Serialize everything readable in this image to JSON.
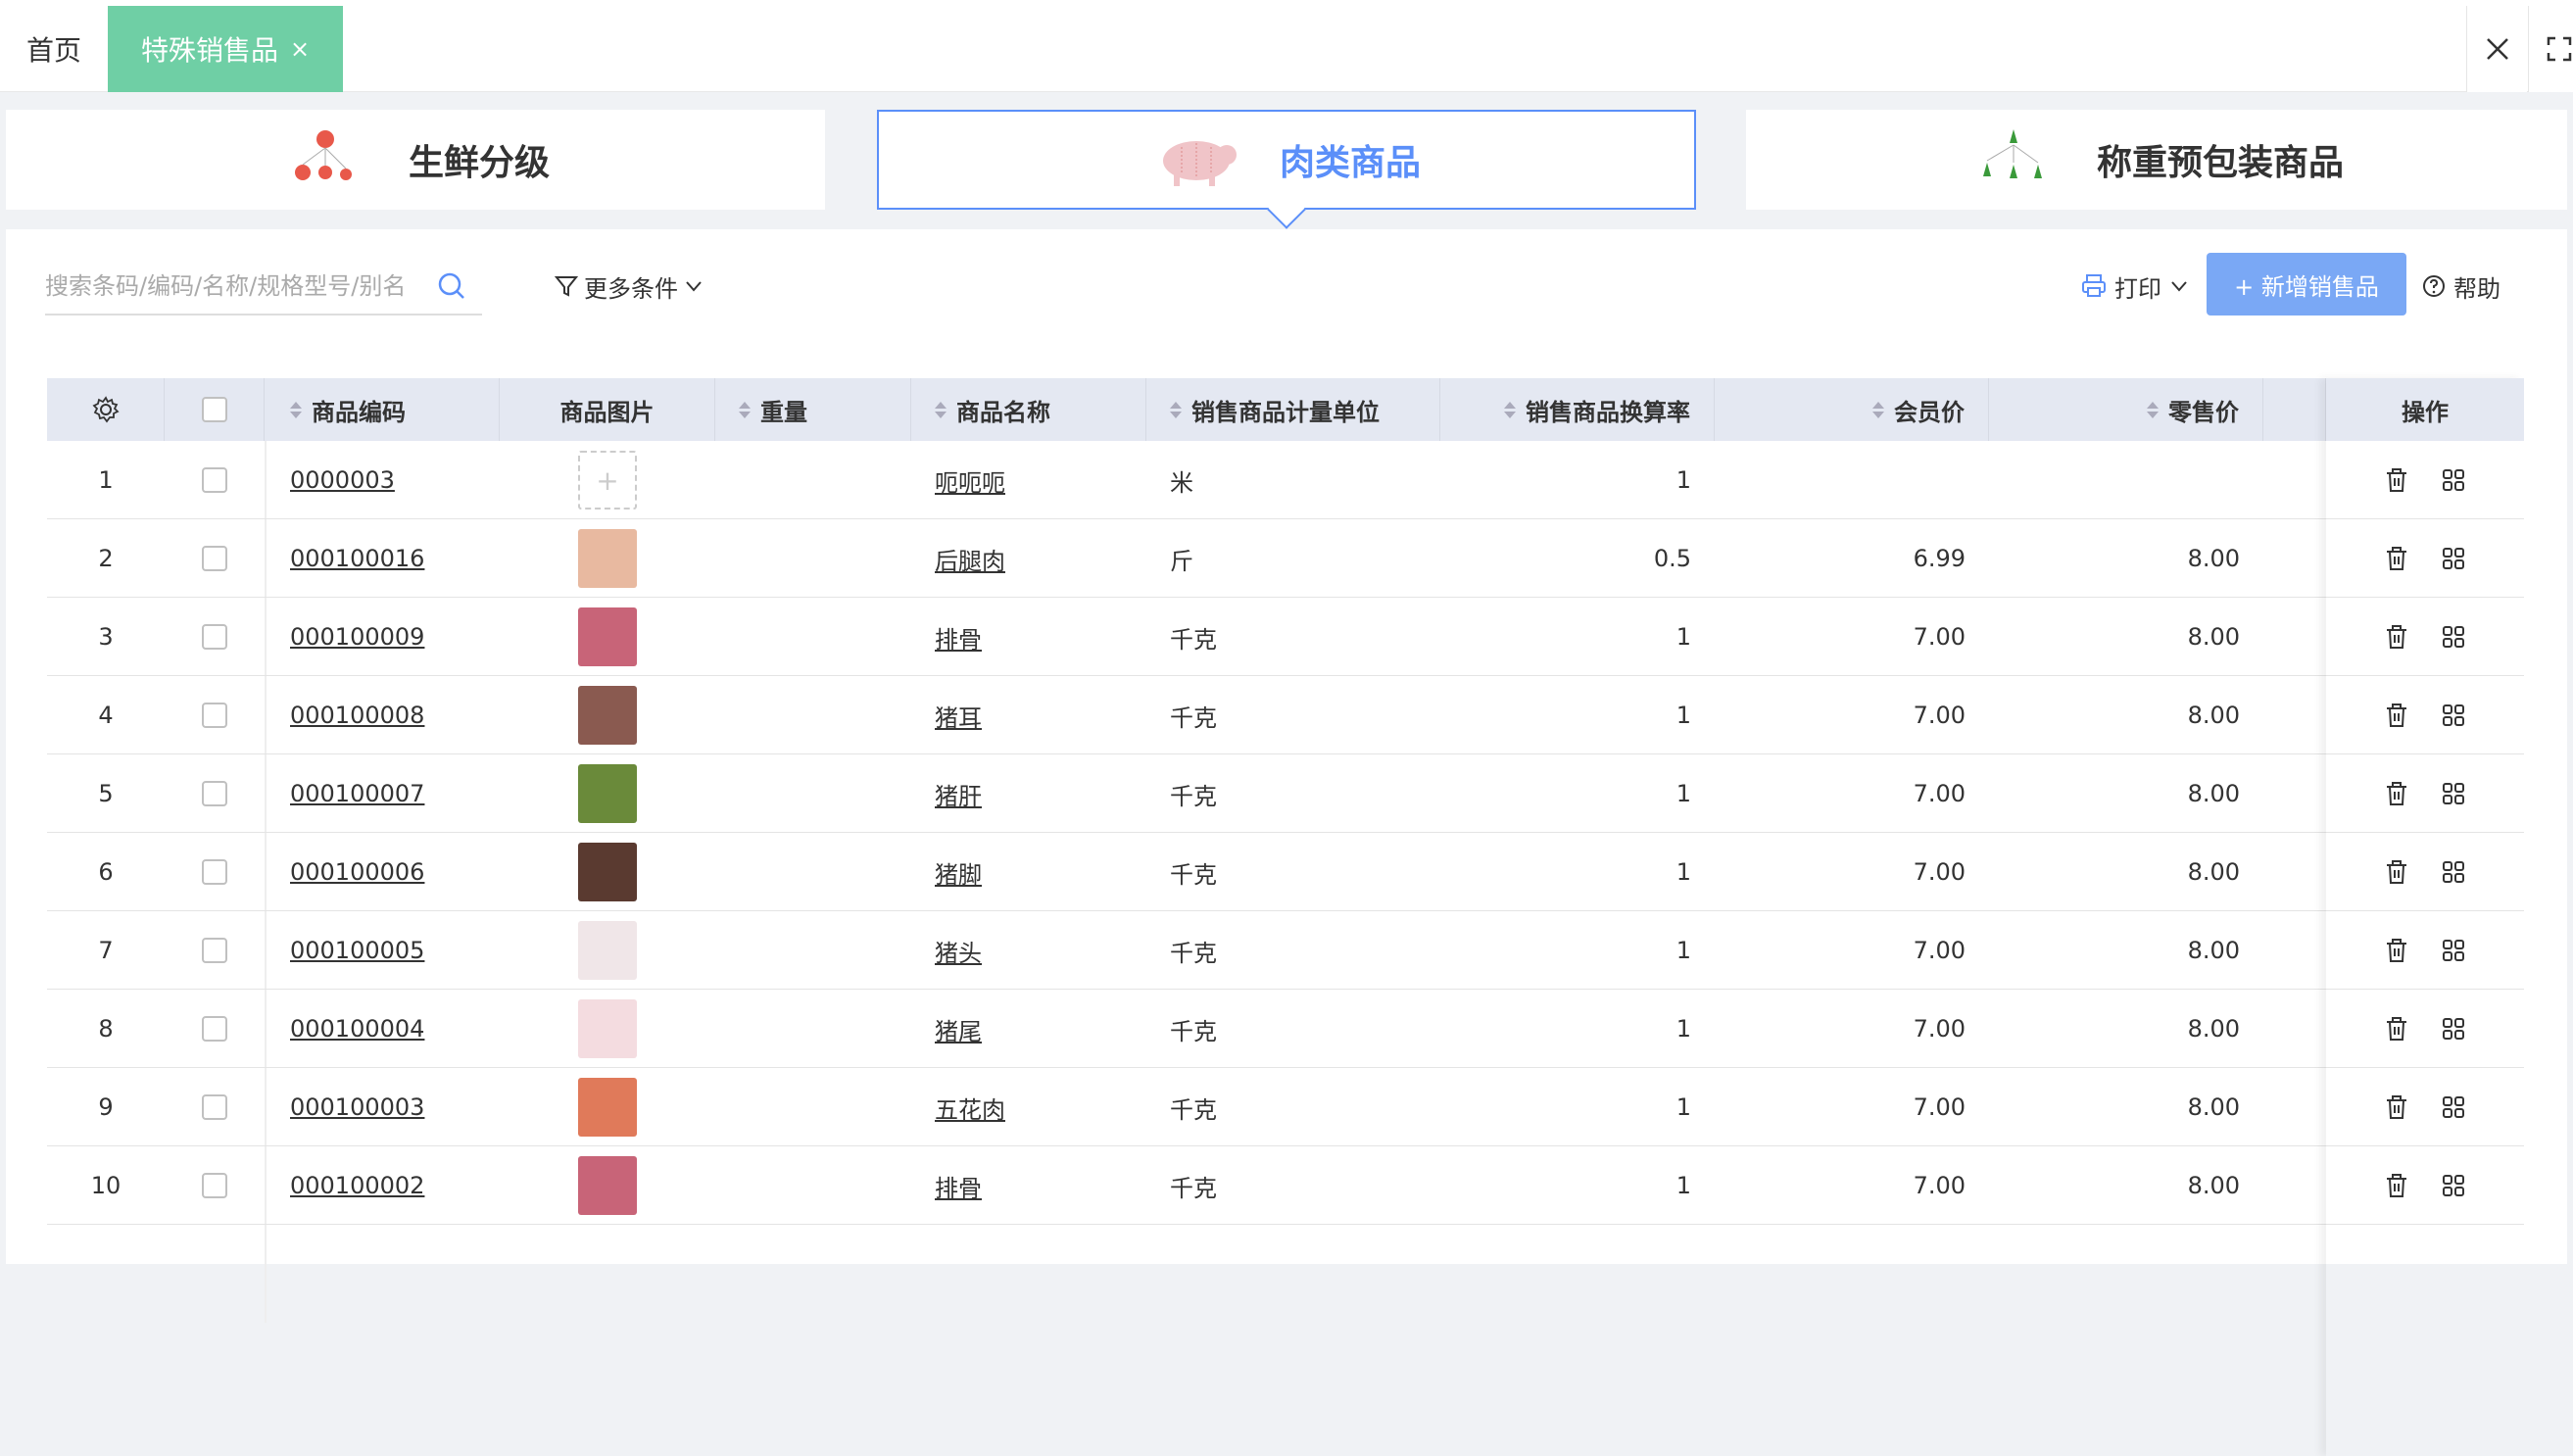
{
  "topbar": {
    "home_tab": "首页",
    "active_tab": "特殊销售品",
    "close_glyph": "×"
  },
  "categories": [
    {
      "label": "生鲜分级",
      "icon": "apple-icon"
    },
    {
      "label": "肉类商品",
      "icon": "pig-icon",
      "active": true
    },
    {
      "label": "称重预包装商品",
      "icon": "vegetable-icon"
    }
  ],
  "toolbar": {
    "search_placeholder": "搜索条码/编码/名称/规格型号/别名",
    "more_label": "更多条件",
    "print_label": "打印",
    "add_label": "+ 新增销售品",
    "help_label": "帮助"
  },
  "table": {
    "headers": {
      "code": "商品编码",
      "image": "商品图片",
      "weight": "重量",
      "name": "商品名称",
      "unit": "销售商品计量单位",
      "rate": "销售商品换算率",
      "member_price": "会员价",
      "retail_price": "零售价",
      "ops": "操作"
    },
    "rows": [
      {
        "no": "1",
        "code": "0000003",
        "thumb": "empty",
        "name": "呃呃呃",
        "unit": "米",
        "rate": "1",
        "member": "",
        "retail": ""
      },
      {
        "no": "2",
        "code": "000100016",
        "thumb": "#e8b9a0",
        "name": "后腿肉",
        "unit": "斤",
        "rate": "0.5",
        "member": "6.99",
        "retail": "8.00"
      },
      {
        "no": "3",
        "code": "000100009",
        "thumb": "#c86478",
        "name": "排骨",
        "unit": "千克",
        "rate": "1",
        "member": "7.00",
        "retail": "8.00"
      },
      {
        "no": "4",
        "code": "000100008",
        "thumb": "#8a5a50",
        "name": "猪耳",
        "unit": "千克",
        "rate": "1",
        "member": "7.00",
        "retail": "8.00"
      },
      {
        "no": "5",
        "code": "000100007",
        "thumb": "#6a8a3a",
        "name": "猪肝",
        "unit": "千克",
        "rate": "1",
        "member": "7.00",
        "retail": "8.00"
      },
      {
        "no": "6",
        "code": "000100006",
        "thumb": "#5a3a30",
        "name": "猪脚",
        "unit": "千克",
        "rate": "1",
        "member": "7.00",
        "retail": "8.00"
      },
      {
        "no": "7",
        "code": "000100005",
        "thumb": "#f0e6e8",
        "name": "猪头",
        "unit": "千克",
        "rate": "1",
        "member": "7.00",
        "retail": "8.00"
      },
      {
        "no": "8",
        "code": "000100004",
        "thumb": "#f4dce0",
        "name": "猪尾",
        "unit": "千克",
        "rate": "1",
        "member": "7.00",
        "retail": "8.00"
      },
      {
        "no": "9",
        "code": "000100003",
        "thumb": "#e07a5a",
        "name": "五花肉",
        "unit": "千克",
        "rate": "1",
        "member": "7.00",
        "retail": "8.00"
      },
      {
        "no": "10",
        "code": "000100002",
        "thumb": "#c86478",
        "name": "排骨",
        "unit": "千克",
        "rate": "1",
        "member": "7.00",
        "retail": "8.00"
      }
    ]
  },
  "colors": {
    "active_tab": "#6fcfa5",
    "accent_blue": "#5b8ff9",
    "add_button": "#7aa8f5"
  }
}
